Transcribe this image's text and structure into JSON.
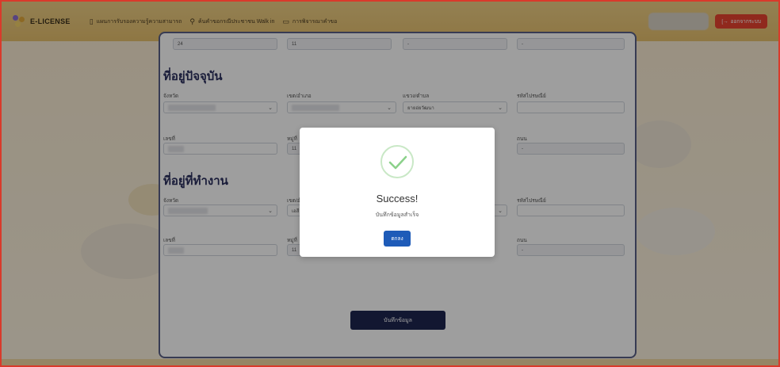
{
  "nav": {
    "brand": "E-LICENSE",
    "items": [
      {
        "icon": "book-icon",
        "label": "แผนการรับรองความรู้ความสามารถ"
      },
      {
        "icon": "search-user-icon",
        "label": "ค้นคำขอกรณีประชาชน Walk in"
      },
      {
        "icon": "clipboard-icon",
        "label": "การพิจารณาคำขอ"
      }
    ],
    "logout_label": "ออกจากระบบ"
  },
  "top_row": {
    "values": [
      "24",
      "11",
      "-",
      "-"
    ]
  },
  "current_address": {
    "title": "ที่อยู่ปัจจุบัน",
    "labels": {
      "province": "จังหวัด",
      "district": "เขต/อำเภอ",
      "subdistrict": "แขวง/ตำบล",
      "postal": "รหัสไปรษณีย์",
      "house_no": "เลขที่",
      "moo": "หมู่ที่",
      "road": "ถนน"
    },
    "values": {
      "subdistrict": "ยายอ่ยวัฒนา",
      "moo": "11",
      "road": "-"
    }
  },
  "work_address": {
    "title": "ที่อยู่ที่ทำงาน",
    "labels": {
      "province": "จังหวัด",
      "district": "เขต/อำเภอ",
      "postal": "รหัสไปรษณีย์",
      "house_no": "เลขที่",
      "moo": "หมู่ที่",
      "road": "ถนน"
    },
    "values": {
      "district": "เอสี",
      "moo": "11",
      "road": "-"
    }
  },
  "save_label": "บันทึกข้อมูล",
  "modal": {
    "title": "Success!",
    "message": "บันทึกข้อมูลสำเร็จ",
    "ok_label": "ตกลง"
  }
}
